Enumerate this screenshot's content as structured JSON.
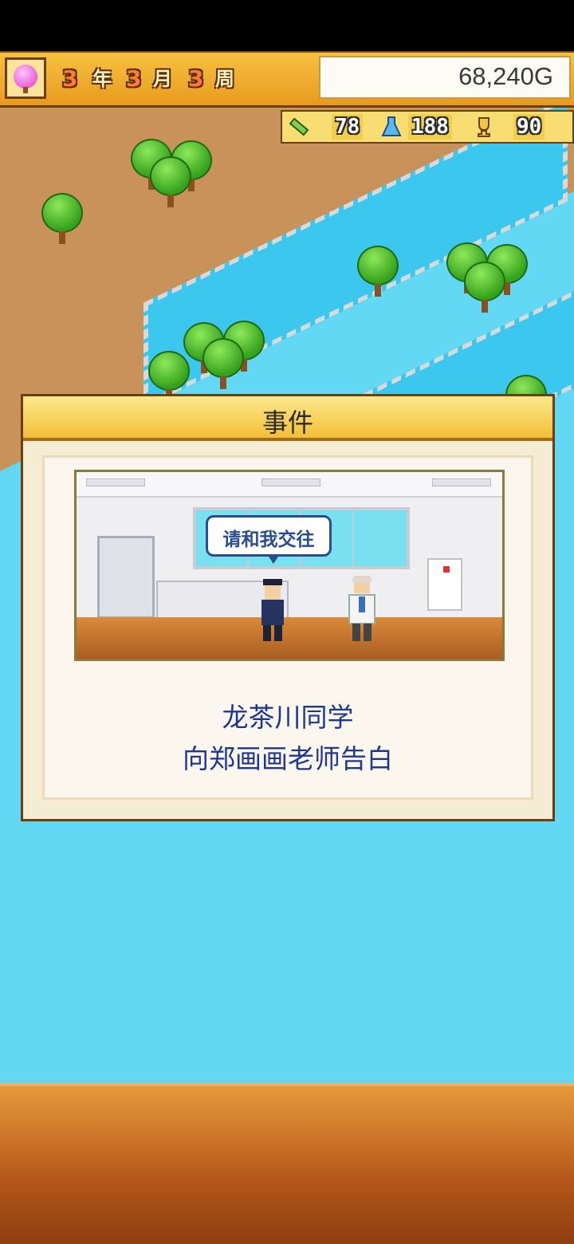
{
  "hud": {
    "season_icon": "pink-tree-icon",
    "date": {
      "year_num": "3",
      "year_unit": "年",
      "month_num": "3",
      "month_unit": "月",
      "week_num": "3",
      "week_unit": "周"
    },
    "money": "68,240G"
  },
  "resources": [
    {
      "icon": "pencil-icon",
      "value": "78"
    },
    {
      "icon": "flask-icon",
      "value": "188"
    },
    {
      "icon": "trophy-icon",
      "value": "90"
    }
  ],
  "event": {
    "title": "事件",
    "speech": "请和我交往",
    "line1": "龙茶川同学",
    "line2": "向郑画画老师告白"
  },
  "colors": {
    "hud": "#f2ad2f",
    "water": "#3cc7ef",
    "message_text": "#1e3790",
    "panel": "#b4561a"
  }
}
